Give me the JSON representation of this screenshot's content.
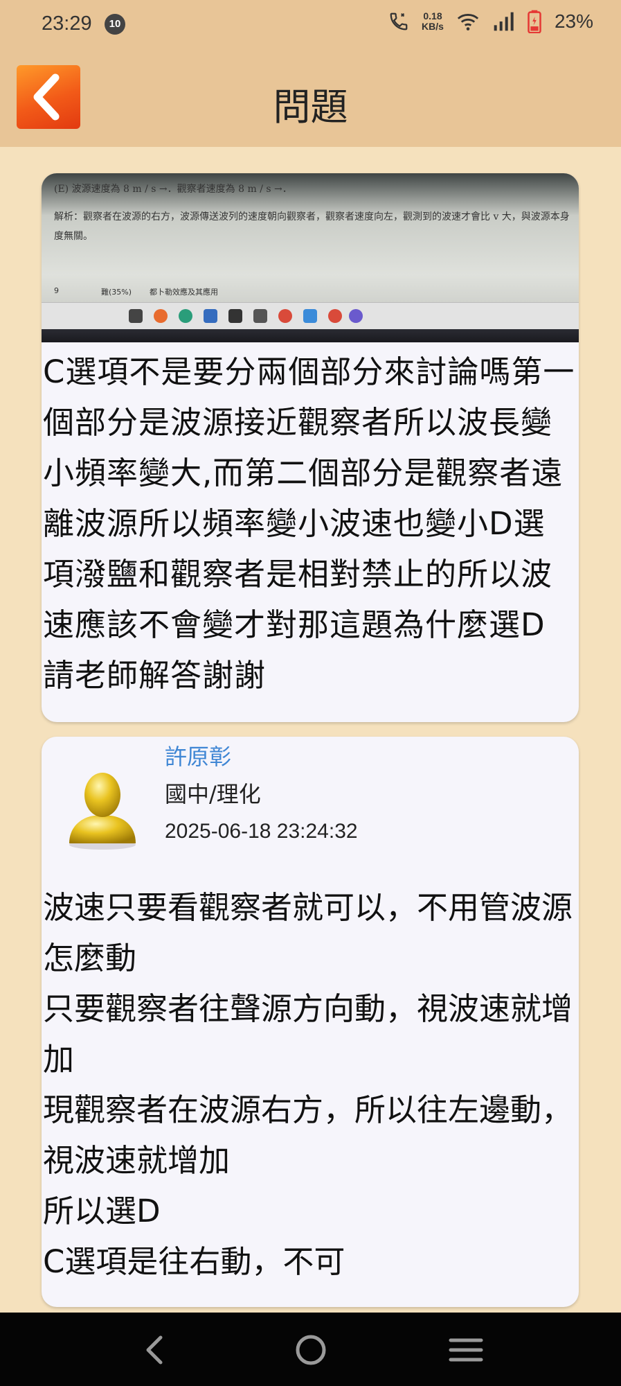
{
  "status_bar": {
    "time": "23:29",
    "notification_count": "10",
    "net_speed_value": "0.18",
    "net_speed_unit": "KB/s",
    "battery_percent": "23%",
    "icons": [
      "call-icon",
      "wifi-icon",
      "signal-icon",
      "battery-icon"
    ]
  },
  "header": {
    "title": "問題",
    "back_icon": "chevron-left-icon",
    "accent_color": "#f25a18"
  },
  "question": {
    "photo": {
      "line1": "(E) 波源速度為 8 m / s →．觀察者速度為 8 m / s →．",
      "line2": "解析：觀察者在波源的右方，波源傳送波列的速度朝向觀察者，觀察者速度向左，觀測到的波速才會比 v 大，與波源本身",
      "line3": "度無關。",
      "footer_left": "9",
      "footer_mid": "難(35%)",
      "footer_right": "都卜勒效應及其應用"
    },
    "text": "C選項不是要分兩個部分來討論嗎第一個部分是波源接近觀察者所以波長變小頻率變大,而第二個部分是觀察者遠離波源所以頻率變小波速也變小D選項潑鹽和觀察者是相對禁止的所以波速應該不會變才對那這題為什麼選D請老師解答謝謝"
  },
  "answer": {
    "teacher_name": "許原彰",
    "subject": "國中/理化",
    "timestamp": "2025-06-18 23:24:32",
    "avatar_icon": "user-avatar-icon",
    "text": "波速只要看觀察者就可以，不用管波源怎麼動\n只要觀察者往聲源方向動，視波速就增加\n現觀察者在波源右方，所以往左邊動，視波速就增加\n所以選D\nC選項是往右動，不可"
  },
  "nav": {
    "icons": [
      "nav-back-icon",
      "nav-home-icon",
      "nav-recents-icon"
    ]
  }
}
